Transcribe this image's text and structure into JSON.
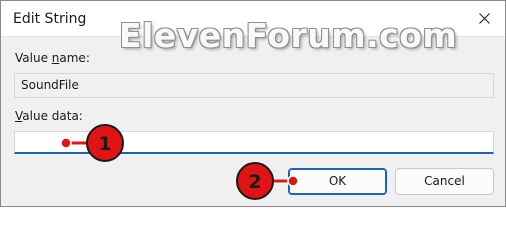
{
  "window": {
    "title": "Edit String",
    "close_icon": "close-icon"
  },
  "watermark": "ElevenForum.com",
  "fields": {
    "value_name_label_prefix": "Value ",
    "value_name_label_accel": "n",
    "value_name_label_suffix": "ame:",
    "value_name": "SoundFile",
    "value_data_label_accel": "V",
    "value_data_label_suffix": "alue data:",
    "value_data": ""
  },
  "buttons": {
    "ok": "OK",
    "cancel": "Cancel"
  },
  "callouts": [
    {
      "number": "1"
    },
    {
      "number": "2"
    }
  ],
  "colors": {
    "accent": "#1a63b8",
    "callout_fill": "#e01414"
  }
}
